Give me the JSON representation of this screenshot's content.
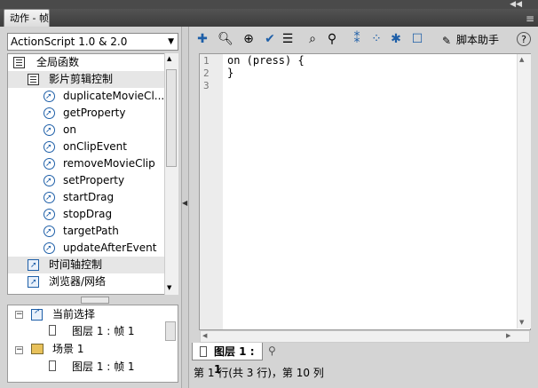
{
  "panel": {
    "tab_title": "动作 - 帧"
  },
  "left": {
    "language": "ActionScript 1.0 & 2.0",
    "tree": [
      {
        "label": "全局函数",
        "icon": "book-icon"
      },
      {
        "label": "影片剪辑控制",
        "icon": "book-icon"
      },
      {
        "label": "duplicateMovieCl...",
        "icon": "action-icon"
      },
      {
        "label": "getProperty",
        "icon": "action-icon"
      },
      {
        "label": "on",
        "icon": "action-icon"
      },
      {
        "label": "onClipEvent",
        "icon": "action-icon"
      },
      {
        "label": "removeMovieClip",
        "icon": "action-icon"
      },
      {
        "label": "setProperty",
        "icon": "action-icon"
      },
      {
        "label": "startDrag",
        "icon": "action-icon"
      },
      {
        "label": "stopDrag",
        "icon": "action-icon"
      },
      {
        "label": "targetPath",
        "icon": "action-icon"
      },
      {
        "label": "updateAfterEvent",
        "icon": "action-icon"
      },
      {
        "label": "时间轴控制",
        "icon": "category-icon"
      },
      {
        "label": "浏览器/网络",
        "icon": "category-icon"
      }
    ],
    "scope": [
      {
        "label": "当前选择"
      },
      {
        "label": "图层 1 : 帧 1"
      },
      {
        "label": "场景 1"
      },
      {
        "label": "图层 1 : 帧 1"
      }
    ]
  },
  "toolbar": {
    "buttons": [
      "add-icon",
      "find-icon",
      "target-icon",
      "check-syntax-icon",
      "auto-format-icon",
      "code-hint-icon",
      "debug-icon",
      "collapse-icon",
      "collapse-selection-icon",
      "expand-all-icon",
      "comment-icon"
    ],
    "script_assist": "脚本助手",
    "help": "?"
  },
  "editor": {
    "lines": [
      {
        "num": "1",
        "text": "on (press) {"
      },
      {
        "num": "2",
        "text": "}"
      },
      {
        "num": "3",
        "text": ""
      }
    ]
  },
  "bottom": {
    "frame_tab": "图层 1 : 1",
    "status": "第 1 行(共 3 行)，第 10 列"
  }
}
